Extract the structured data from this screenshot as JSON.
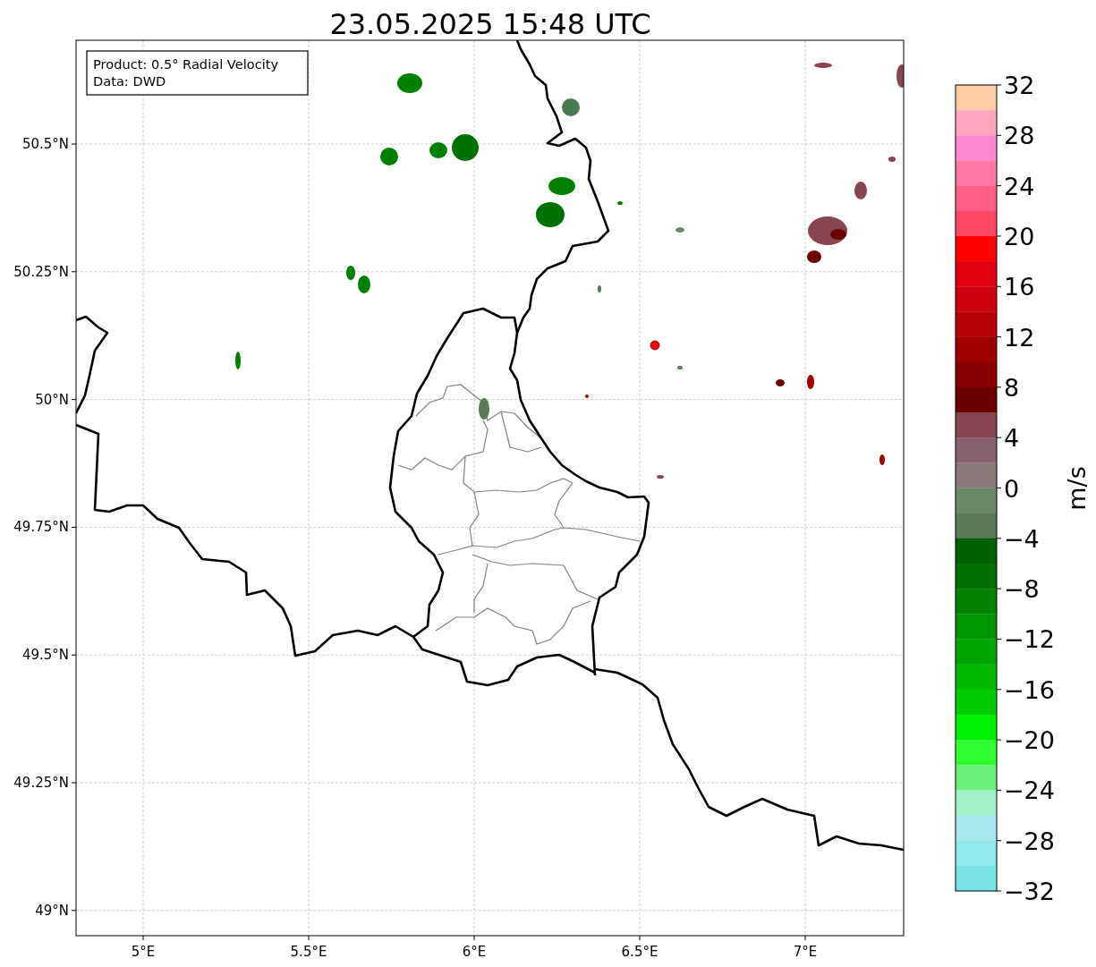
{
  "title": "23.05.2025 15:48 UTC",
  "legend": [
    "Product: 0.5° Radial Velocity",
    "Data: DWD"
  ],
  "map": {
    "lat_labels": [
      "50.5°N",
      "50.25°N",
      "50°N",
      "49.75°N",
      "49.5°N",
      "49.25°N",
      "49°N"
    ],
    "lon_labels": [
      "5°E",
      "5.5°E",
      "6°E",
      "6.5°E",
      "7°E"
    ]
  },
  "colorbar": {
    "label": "m/s",
    "ticks": [
      "32",
      "28",
      "24",
      "20",
      "16",
      "12",
      "8",
      "4",
      "0",
      "−4",
      "−8",
      "−12",
      "−16",
      "−20",
      "−24",
      "−28",
      "−32"
    ],
    "segments": [
      {
        "color": "#ffcca8"
      },
      {
        "color": "#ffa8c0"
      },
      {
        "color": "#ff88d0"
      },
      {
        "color": "#ff78a8"
      },
      {
        "color": "#ff6088"
      },
      {
        "color": "#ff4868"
      },
      {
        "color": "#ff0000"
      },
      {
        "color": "#e00010"
      },
      {
        "color": "#cc0010"
      },
      {
        "color": "#b80008"
      },
      {
        "color": "#a00000"
      },
      {
        "color": "#880000"
      },
      {
        "color": "#6c0000"
      },
      {
        "color": "#884450"
      },
      {
        "color": "#886070"
      },
      {
        "color": "#887878"
      },
      {
        "color": "#6a8868"
      },
      {
        "color": "#5a7a58"
      },
      {
        "color": "#006000"
      },
      {
        "color": "#007000"
      },
      {
        "color": "#008200"
      },
      {
        "color": "#009400"
      },
      {
        "color": "#00a400"
      },
      {
        "color": "#00b800"
      },
      {
        "color": "#00cc00"
      },
      {
        "color": "#00ee00"
      },
      {
        "color": "#30ff30"
      },
      {
        "color": "#68f078"
      },
      {
        "color": "#a0f0c8"
      },
      {
        "color": "#a8e8ee"
      },
      {
        "color": "#90e8ec"
      },
      {
        "color": "#78e4e8"
      }
    ]
  }
}
